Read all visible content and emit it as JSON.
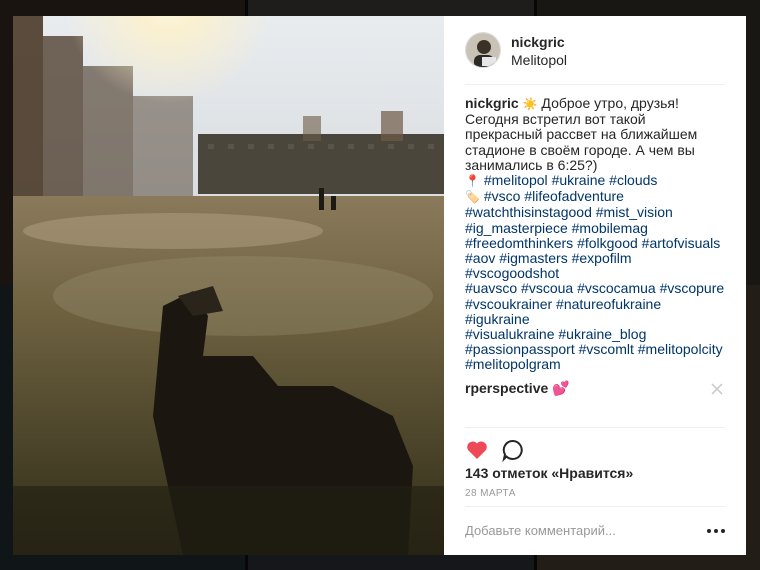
{
  "post": {
    "username": "nickgric",
    "location": "Melitopol",
    "avatar_icon": "person-avatar",
    "caption_emoji": "sun-emoji",
    "caption_text": " Доброе утро, друзья! Сегодня встретил вот такой прекрасный рассвет на ближайшем стадионе в своём городе. А чем вы занимались в 6:25?)",
    "hashtag_lines": [
      {
        "emoji": "📍",
        "tags": [
          "#melitopol",
          "#ukraine",
          "#clouds"
        ]
      },
      {
        "emoji": "🏷️",
        "tags": [
          "#vsco",
          "#lifeofadventure"
        ]
      },
      {
        "emoji": "",
        "tags": [
          "#watchthisinstagood",
          "#mist_vision"
        ]
      },
      {
        "emoji": "",
        "tags": [
          "#ig_masterpiece",
          "#mobilemag"
        ]
      },
      {
        "emoji": "",
        "tags": [
          "#freedomthinkers",
          "#folkgood",
          "#artofvisuals"
        ]
      },
      {
        "emoji": "",
        "tags": [
          "#aov",
          "#igmasters",
          "#expofilm",
          "#vscogoodshot"
        ]
      },
      {
        "emoji": "",
        "tags": [
          "#uavsco",
          "#vscoua",
          "#vscocamua",
          "#vscopure"
        ]
      },
      {
        "emoji": "",
        "tags": [
          "#vscoukrainer",
          "#natureofukraine",
          "#igukraine"
        ]
      },
      {
        "emoji": "",
        "tags": [
          "#visualukraine",
          "#ukraine_blog"
        ]
      },
      {
        "emoji": "",
        "tags": [
          "#passionpassport",
          "#vscomlt",
          "#melitopolcity"
        ]
      },
      {
        "emoji": "",
        "tags": [
          "#melitopolgram"
        ]
      }
    ],
    "comments": [
      {
        "username": "rperspective",
        "text": " 💕"
      }
    ],
    "likes_text": "143 отметок «Нравится»",
    "date": "28 МАРТА",
    "comment_placeholder": "Добавьте комментарий...",
    "colors": {
      "heart": "#ed4956",
      "hashtag": "#003569",
      "text": "#262626",
      "muted": "#999999"
    },
    "icons": [
      "heart-icon",
      "comment-icon",
      "close-icon",
      "more-options-icon",
      "location-pin-emoji",
      "tag-emoji",
      "sparkle-heart-emoji"
    ]
  }
}
